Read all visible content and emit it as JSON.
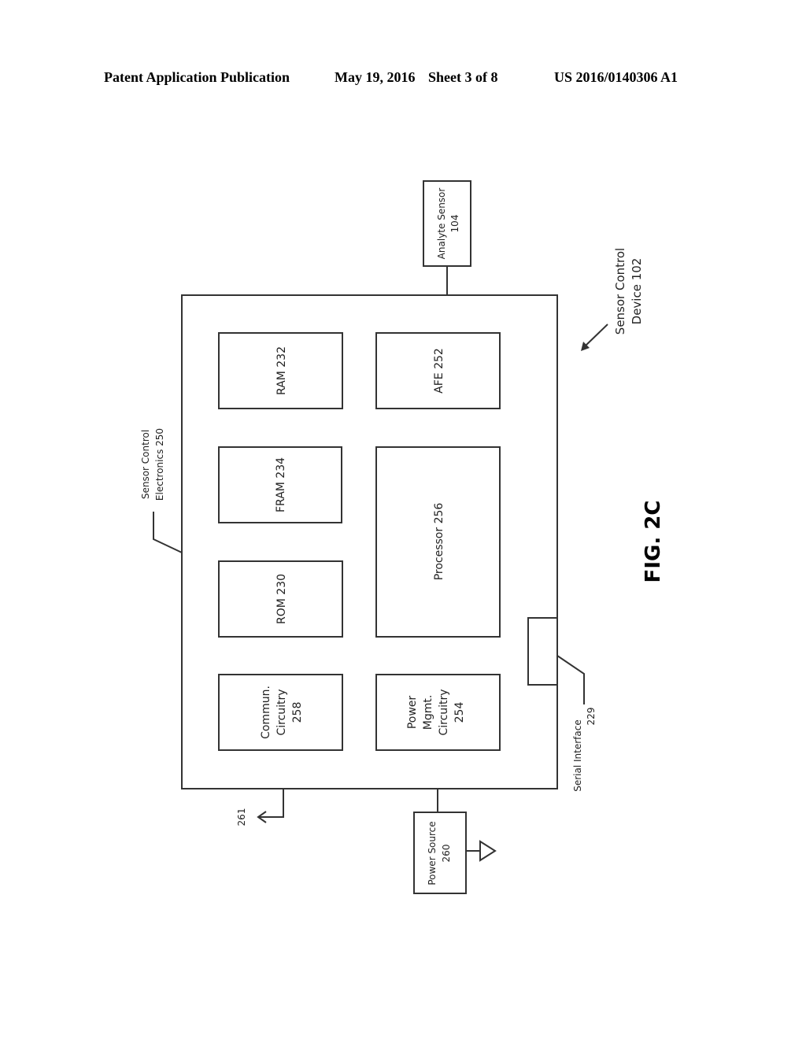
{
  "header": {
    "publication_type": "Patent Application Publication",
    "date": "May 19, 2016",
    "sheet": "Sheet 3 of 8",
    "publication_number": "US 2016/0140306 A1"
  },
  "figure": {
    "label": "FIG. 2C",
    "device_label_line1": "Sensor Control",
    "device_label_line2": "Device 102",
    "electronics_label_line1": "Sensor Control",
    "electronics_label_line2": "Electronics 250",
    "analyte_sensor_line1": "Analyte Sensor",
    "analyte_sensor_line2": "104",
    "blocks": {
      "ram": "RAM 232",
      "fram": "FRAM 234",
      "rom": "ROM 230",
      "commun_line1": "Commun.",
      "commun_line2": "Circuitry",
      "commun_line3": "258",
      "afe": "AFE 252",
      "processor": "Processor 256",
      "power_mgmt_line1": "Power",
      "power_mgmt_line2": "Mgmt.",
      "power_mgmt_line3": "Circuitry",
      "power_mgmt_line4": "254"
    },
    "serial_interface_line1": "Serial Interface",
    "serial_interface_line2": "229",
    "antenna_label": "261",
    "power_source_line1": "Power Source",
    "power_source_line2": "260"
  }
}
